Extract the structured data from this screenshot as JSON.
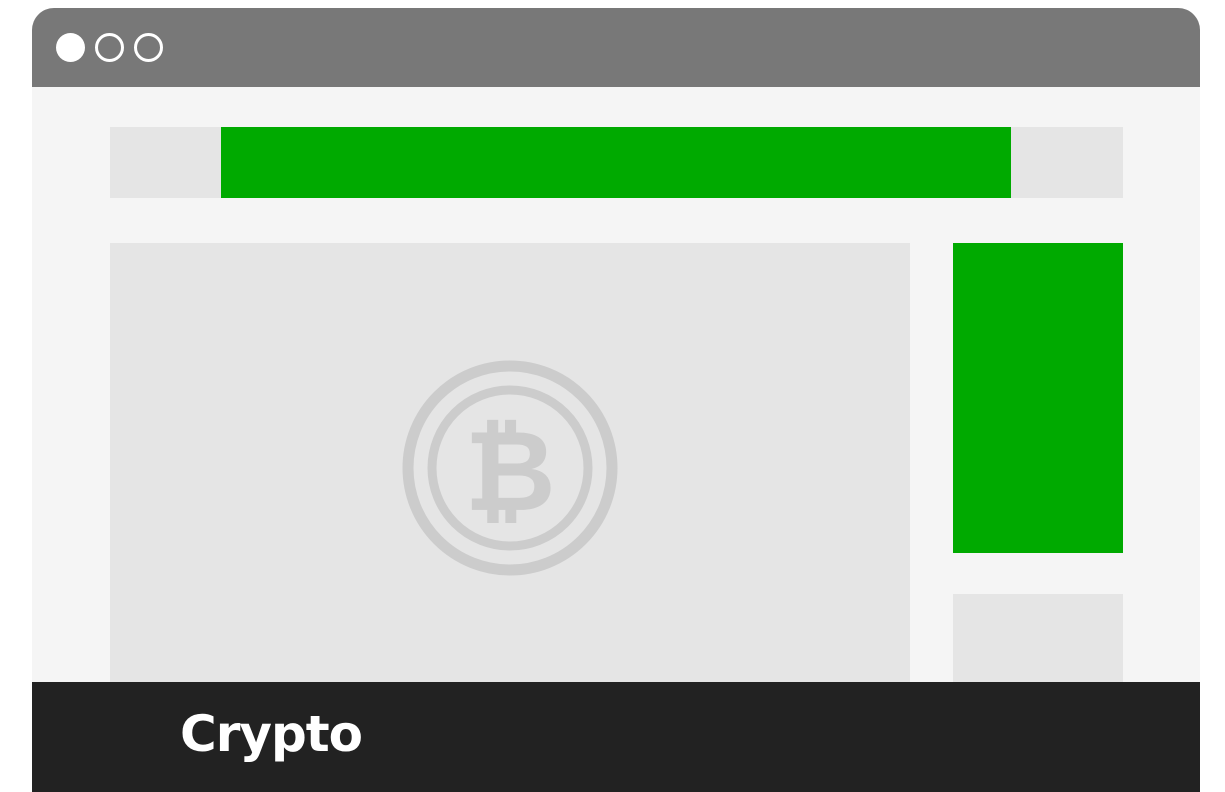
{
  "window": {
    "titlebar_color": "#787878",
    "background_color": "#f5f5f5",
    "controls": [
      "window-dot-filled",
      "window-dot-outline",
      "window-dot-outline"
    ]
  },
  "ads": {
    "color": "#00aa00",
    "banner": "top-banner-ad",
    "sidebar": "sidebar-ad"
  },
  "main": {
    "icon": "bitcoin-icon",
    "icon_color": "#cccccc",
    "placeholder_color": "#e5e5e5"
  },
  "caption": {
    "label": "Crypto",
    "background_color": "#222222",
    "text_color": "#ffffff"
  }
}
